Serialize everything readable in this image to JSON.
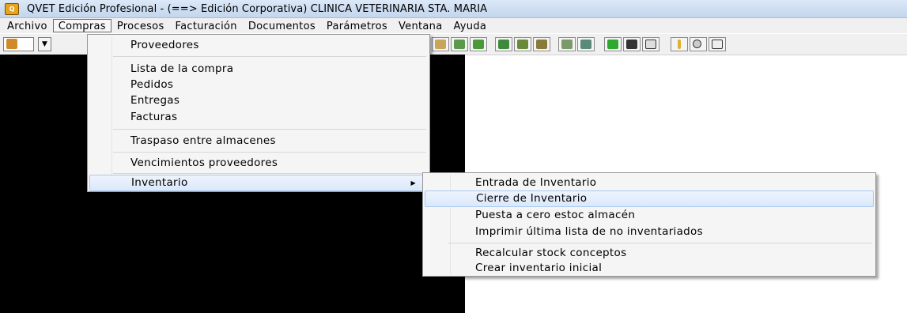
{
  "window": {
    "title": "QVET Edición Profesional -  (==> Edición Corporativa) CLINICA VETERINARIA STA. MARIA",
    "icon": "app-logo-icon"
  },
  "menubar": {
    "items": [
      {
        "label": "Archivo"
      },
      {
        "label": "Compras",
        "active": true
      },
      {
        "label": "Procesos"
      },
      {
        "label": "Facturación"
      },
      {
        "label": "Documentos"
      },
      {
        "label": "Parámetros"
      },
      {
        "label": "Ventana"
      },
      {
        "label": "Ayuda"
      }
    ]
  },
  "compras_menu": {
    "items": {
      "proveedores": "Proveedores",
      "lista_compra": "Lista de la compra",
      "pedidos": "Pedidos",
      "entregas": "Entregas",
      "facturas": "Facturas",
      "traspaso": "Traspaso entre almacenes",
      "vencimientos": "Vencimientos proveedores",
      "inventario": "Inventario"
    }
  },
  "inventario_menu": {
    "items": {
      "entrada": "Entrada de Inventario",
      "cierre": "Cierre de Inventario",
      "puesta_cero": "Puesta a cero estoc almacén",
      "imprimir": "Imprimir última lista de no inventariados",
      "recalcular": "Recalcular stock conceptos",
      "crear": "Crear inventario inicial"
    }
  },
  "colors": {
    "titlebar": "#c3d6ee",
    "menubar": "#f0f0f0",
    "workspace": "#000000",
    "highlight": "#dbe8fa"
  }
}
